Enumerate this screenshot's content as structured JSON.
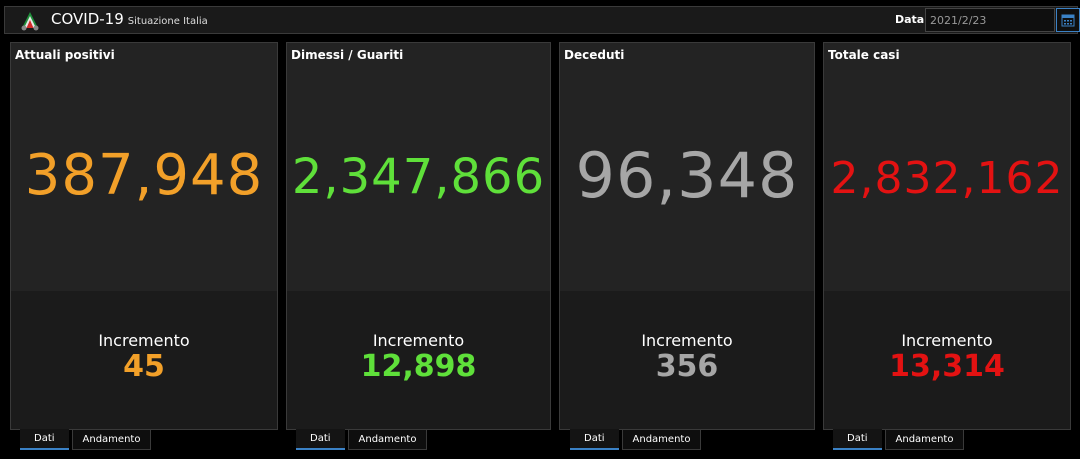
{
  "header": {
    "title": "COVID-19",
    "subtitle": "Situazione Italia",
    "date_label": "Data",
    "date_value": "2021/2/23"
  },
  "cards": [
    {
      "title": "Attuali positivi",
      "value": "387,948",
      "increment_label": "Incremento",
      "increment": "45",
      "color": "#f2a029"
    },
    {
      "title": "Dimessi / Guariti",
      "value": "2,347,866",
      "increment_label": "Incremento",
      "increment": "12,898",
      "color": "#5fe03a"
    },
    {
      "title": "Deceduti",
      "value": "96,348",
      "increment_label": "Incremento",
      "increment": "356",
      "color": "#a6a6a6"
    },
    {
      "title": "Totale casi",
      "value": "2,832,162",
      "increment_label": "Incremento",
      "increment": "13,314",
      "color": "#e31212"
    }
  ],
  "tabs": [
    "Dati",
    "Andamento"
  ],
  "icons": {
    "logo": "italy-republic-logo-icon",
    "calendar": "calendar-icon"
  }
}
